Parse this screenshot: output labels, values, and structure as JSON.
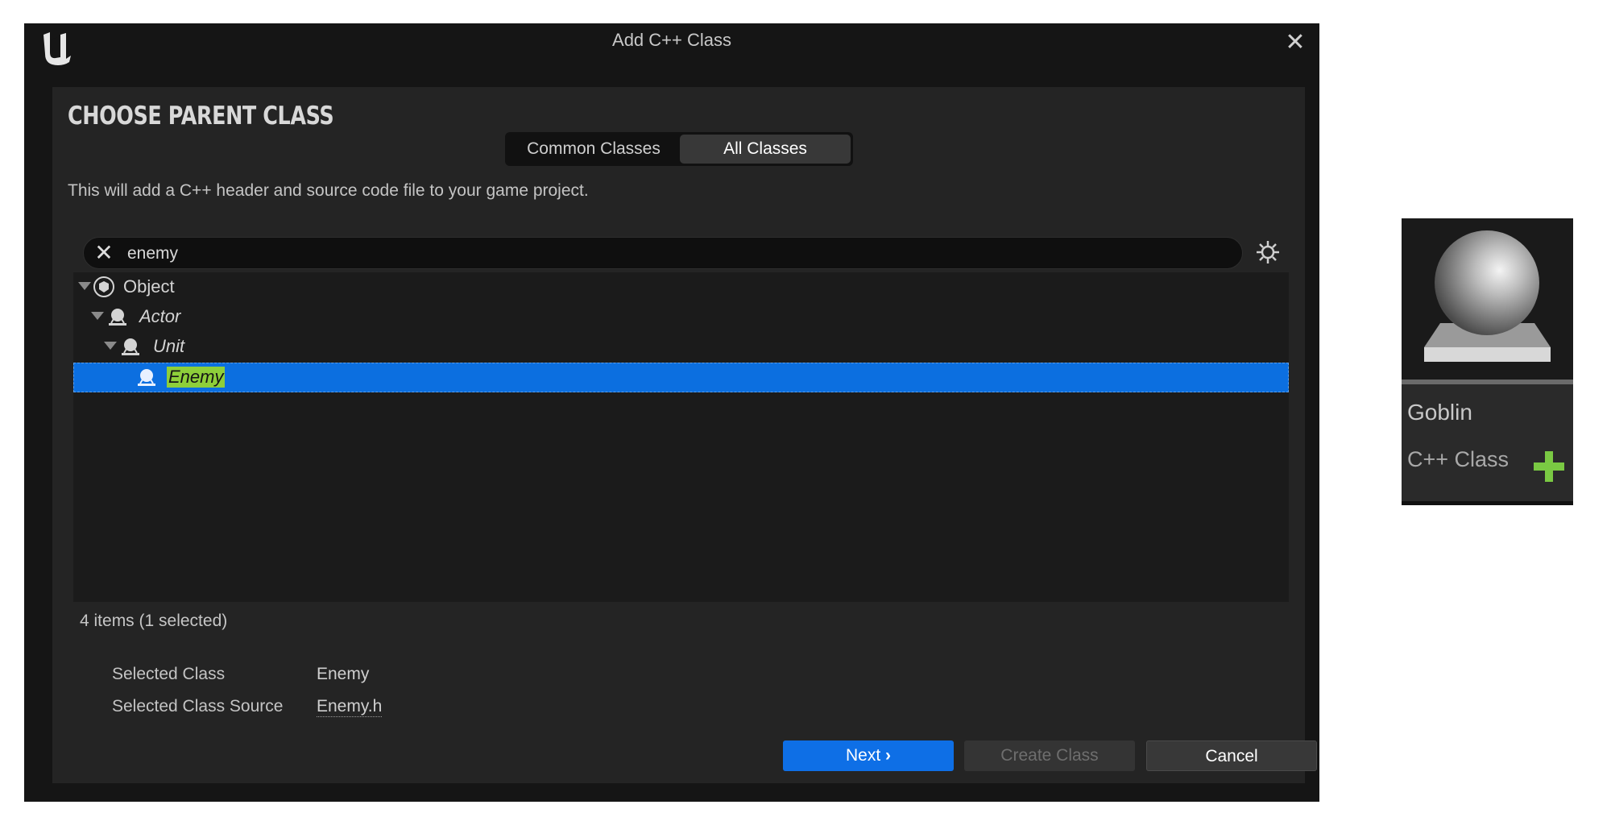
{
  "window": {
    "title": "Add C++ Class",
    "logo_icon": "unreal-engine-logo-icon",
    "close_icon": "close-icon"
  },
  "header": {
    "heading": "CHOOSE PARENT CLASS",
    "description": "This will add a C++ header and source code file to your game project."
  },
  "tabs": [
    {
      "label": "Common Classes",
      "active": false
    },
    {
      "label": "All Classes",
      "active": true
    }
  ],
  "search": {
    "value": "enemy",
    "clear_icon": "clear-icon",
    "settings_icon": "gear-icon"
  },
  "tree": {
    "items": [
      {
        "label": "Object",
        "level": 0,
        "expanded": true,
        "italic": false,
        "selected": false,
        "icon": "object-class-icon"
      },
      {
        "label": "Actor",
        "level": 1,
        "expanded": true,
        "italic": true,
        "selected": false,
        "icon": "actor-class-icon"
      },
      {
        "label": "Unit",
        "level": 2,
        "expanded": true,
        "italic": true,
        "selected": false,
        "icon": "actor-class-icon"
      },
      {
        "label": "Enemy",
        "level": 3,
        "expanded": false,
        "italic": true,
        "selected": true,
        "icon": "actor-class-icon"
      }
    ],
    "status": "4 items (1 selected)"
  },
  "details": {
    "selected_class_label": "Selected Class",
    "selected_class_value": "Enemy",
    "selected_source_label": "Selected Class Source",
    "selected_source_value": "Enemy.h"
  },
  "buttons": {
    "next": "Next",
    "next_icon": "chevron-right-icon",
    "create": "Create Class",
    "cancel": "Cancel"
  },
  "thumbnail": {
    "name": "Goblin",
    "type": "C++ Class",
    "preview_icon": "sphere-preview-icon",
    "add_icon": "plus-icon"
  },
  "colors": {
    "selection": "#0c6fe0",
    "highlight": "#8ecf3a",
    "primary_button": "#0e6fe6",
    "plus": "#7ac943"
  }
}
